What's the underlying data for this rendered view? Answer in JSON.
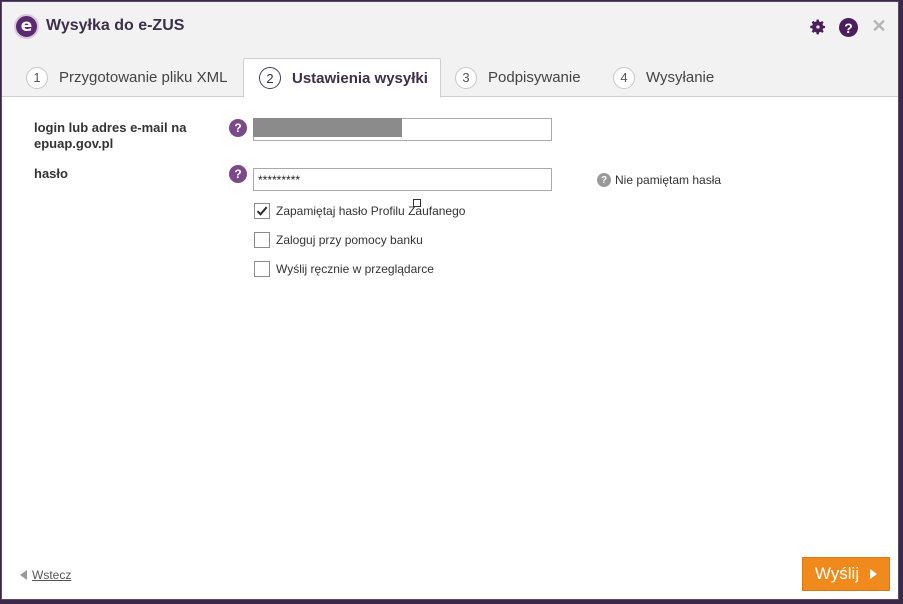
{
  "window": {
    "title": "Wysyłka do e-ZUS",
    "logo_letter": "e",
    "icons": [
      "gear-icon",
      "help-icon",
      "close-icon"
    ]
  },
  "tabs": [
    {
      "num": "1",
      "label": "Przygotowanie pliku XML",
      "active": false
    },
    {
      "num": "2",
      "label": "Ustawienia wysyłki",
      "active": true
    },
    {
      "num": "3",
      "label": "Podpisywanie",
      "active": false
    },
    {
      "num": "4",
      "label": "Wysyłanie",
      "active": false
    }
  ],
  "form": {
    "login_label": "login lub adres e-mail na epuap.gov.pl",
    "login_value": "",
    "password_label": "hasło",
    "password_value": "*********",
    "forgot_label": "Nie pamiętam hasła",
    "help_glyph": "?",
    "checkboxes": [
      {
        "label": "Zapamiętaj hasło Profilu Zaufanego",
        "checked": true
      },
      {
        "label": "Zaloguj przy pomocy banku",
        "checked": false
      },
      {
        "label": "Wyślij ręcznie w przeglądarce",
        "checked": false
      }
    ]
  },
  "footer": {
    "back_label": "Wstecz",
    "send_label": "Wyślij"
  },
  "colors": {
    "accent": "#f08a1c",
    "brand": "#5c2a6e",
    "help_icon": "#7a4a88"
  }
}
